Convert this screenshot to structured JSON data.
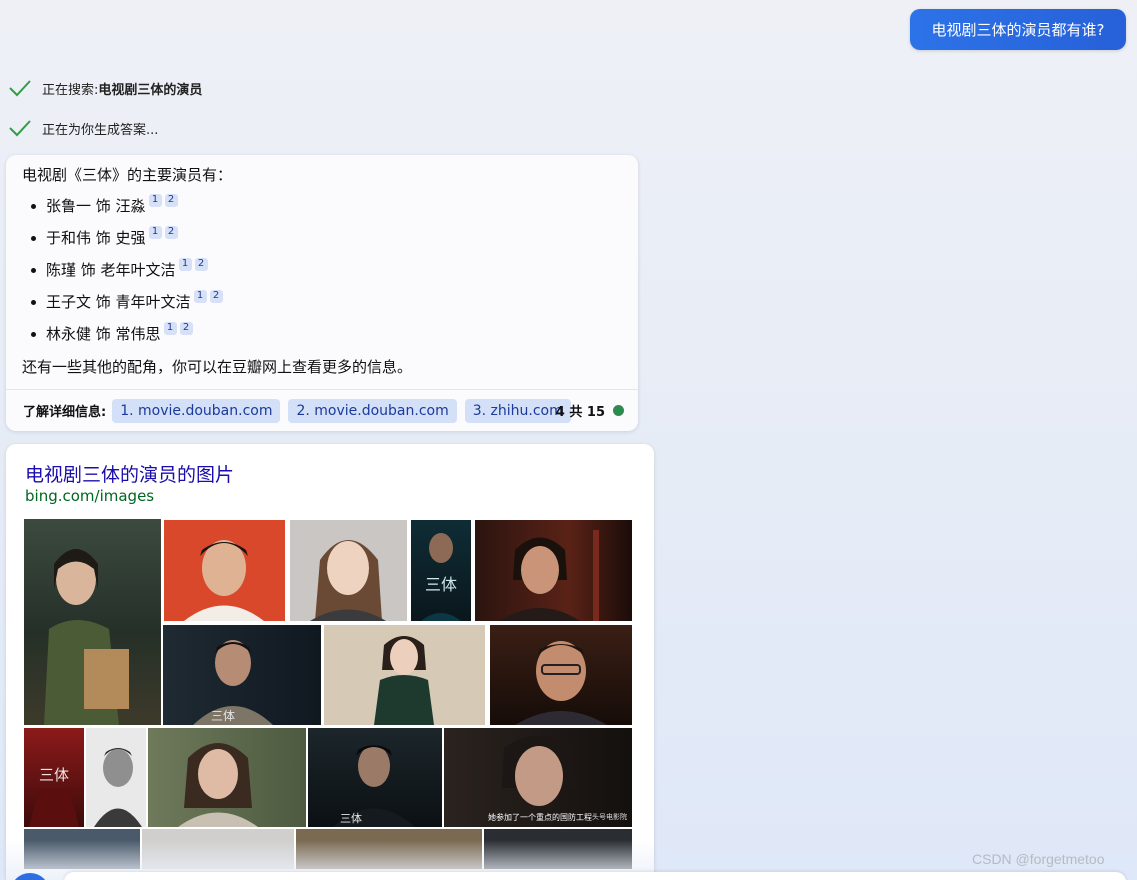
{
  "user_message": "电视剧三体的演员都有谁?",
  "status": {
    "searching_prefix": "正在搜索: ",
    "searching_query": "电视剧三体的演员",
    "generating": "正在为你生成答案..."
  },
  "answer": {
    "intro": "电视剧《三体》的主要演员有：",
    "actors": [
      {
        "text": "张鲁一 饰 汪淼",
        "cites": [
          "1",
          "2"
        ]
      },
      {
        "text": "于和伟 饰 史强",
        "cites": [
          "1",
          "2"
        ]
      },
      {
        "text": "陈瑾 饰 老年叶文洁",
        "cites": [
          "1",
          "2"
        ]
      },
      {
        "text": "王子文 饰 青年叶文洁",
        "cites": [
          "1",
          "2"
        ]
      },
      {
        "text": "林永健 饰 常伟思",
        "cites": [
          "1",
          "2"
        ]
      }
    ],
    "outro": "还有一些其他的配角，你可以在豆瓣网上查看更多的信息。"
  },
  "sources": {
    "label": "了解详细信息:",
    "links": [
      "1. movie.douban.com",
      "2. movie.douban.com",
      "3. zhihu.com"
    ],
    "page_count": "4 共 15"
  },
  "images": {
    "title": "电视剧三体的演员的图片",
    "source": "bing.com/images",
    "thumbnails": [
      "woman-in-green-coat-with-clipboard",
      "actor-red-background",
      "smiling-actress-grey-background",
      "three-body-poster-dark",
      "actress-with-bangs",
      "man-in-coat-three-body",
      "woman-in-plaid-dress",
      "man-with-glasses",
      "three-body-red-poster",
      "man-portrait-black-white",
      "woman-with-scarf",
      "man-in-black-three-body",
      "woman-close-up-film-still",
      "thumbnail-partial-1",
      "thumbnail-partial-2",
      "thumbnail-partial-3",
      "thumbnail-partial-4"
    ],
    "film_still_caption": "她参加了一个重点的国防工程",
    "film_still_watermark": "头号电影院"
  },
  "watermark": "CSDN @forgetmetoo",
  "colors": {
    "user_bubble": "#2d6fe2",
    "link_blue": "#1a0dab",
    "source_green": "#006621",
    "citation_bg": "#d6e1f7",
    "status_dot": "#2f8a4f",
    "check_green": "#2f9e44"
  }
}
